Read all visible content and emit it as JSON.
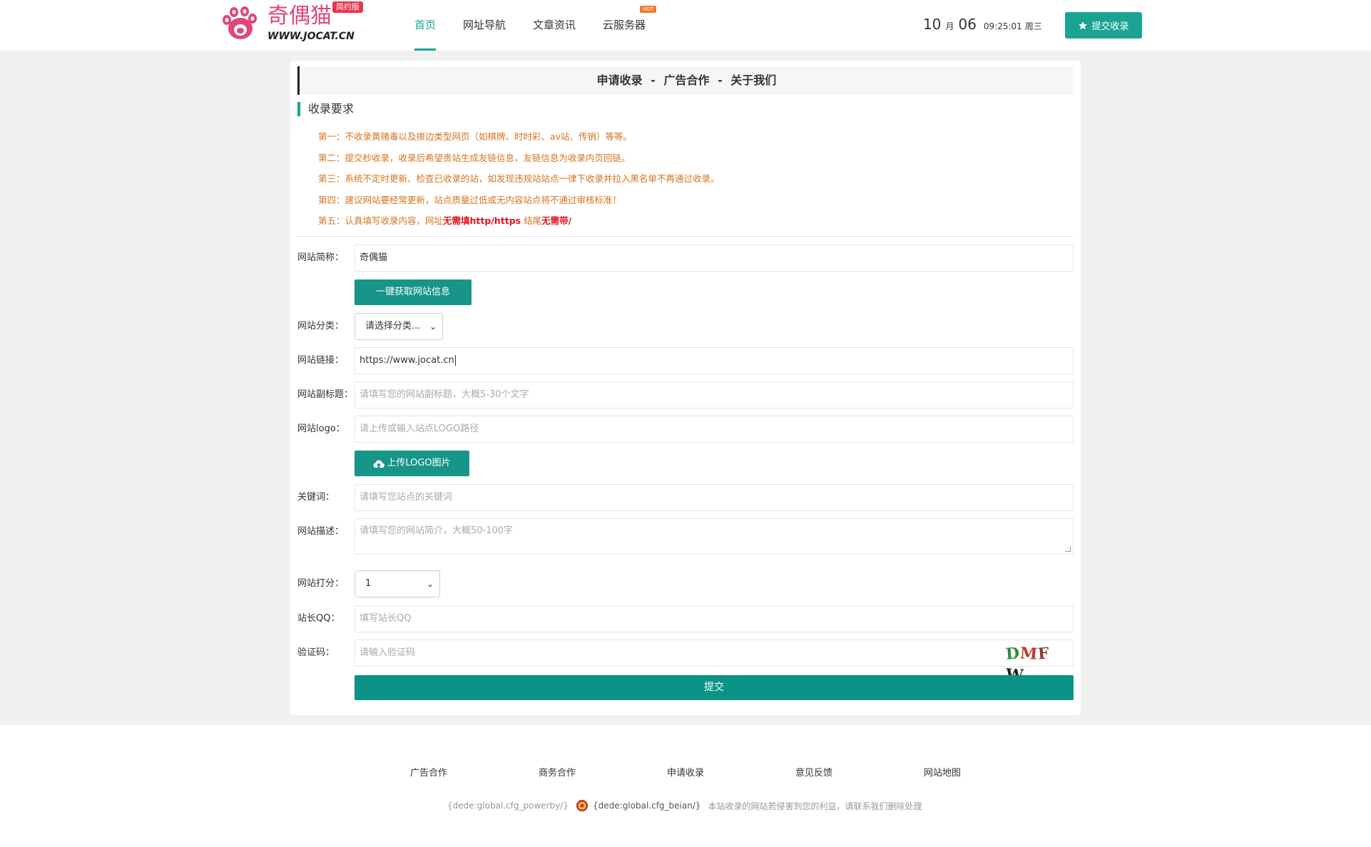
{
  "header": {
    "logo_text": "奇偶猫",
    "logo_url_text": "WWW.JOCAT.CN",
    "logo_badge": "简约版",
    "nav": [
      {
        "label": "首页",
        "active": true
      },
      {
        "label": "网址导航",
        "active": false
      },
      {
        "label": "文章资讯",
        "active": false
      },
      {
        "label": "云服务器",
        "active": false,
        "badge": "HOT"
      }
    ],
    "clock": {
      "month": "10",
      "month_unit": "月",
      "day": "06",
      "time": "09:25:01",
      "weekday": "周三"
    },
    "submit_button": "提交收录"
  },
  "card": {
    "title_parts": [
      "申请收录",
      "-",
      "广告合作",
      "-",
      "关于我们"
    ],
    "section_title": "收录要求",
    "rules": [
      {
        "text": "第一：不收录黄赌毒以及擦边类型网页（如棋牌、时时彩、av站、传销）等等。"
      },
      {
        "text": "第二：提交秒收录，收录后希望贵站生成友链信息，友链信息为收录内页回链。"
      },
      {
        "text": "第三：系统不定时更新、检查已收录的站，如发现违规站站点一律下收录并拉入黑名单不再通过收录。"
      },
      {
        "text": "第四：建议网站要经常更新，站点质量过低或无内容站点将不通过审核标准！"
      },
      {
        "prefix": "第五：认真填写收录内容，网址",
        "strong1": "无需填http/https",
        "middle": " 结尾",
        "strong2": "无需带/"
      }
    ]
  },
  "form": {
    "site_name": {
      "label": "网站简称：",
      "value": "奇偶猫"
    },
    "fetch_button": "一键获取网站信息",
    "category": {
      "label": "网站分类：",
      "value": "请选择分类..."
    },
    "url": {
      "label": "网站链接：",
      "value": "https://www.jocat.cn"
    },
    "subtitle": {
      "label": "网站副标题：",
      "placeholder": "请填写您的网站副标题，大概5-30个文字"
    },
    "logo": {
      "label": "网站logo：",
      "placeholder": "请上传或输入站点LOGO路径"
    },
    "upload_button": "上传LOGO图片",
    "keywords": {
      "label": "关键词：",
      "placeholder": "请填写您站点的关键词"
    },
    "description": {
      "label": "网站描述：",
      "placeholder": "请填写您的网站简介，大概50-100字"
    },
    "rating": {
      "label": "网站打分：",
      "value": "1"
    },
    "qq": {
      "label": "站长QQ：",
      "placeholder": "填写站长QQ"
    },
    "captcha": {
      "label": "验证码：",
      "placeholder": "请输入验证码",
      "code": "DMFW"
    },
    "submit": "提交"
  },
  "footer": {
    "links": [
      "广告合作",
      "商务合作",
      "申请收录",
      "意见反馈",
      "网站地图"
    ],
    "powerby": "{dede:global.cfg_powerby/}",
    "beian": "{dede:global.cfg_beian/}",
    "notice": "本站收录的网站若侵害到您的利益，请联系我们删除处理"
  },
  "colors": {
    "accent": "#1aa394",
    "rule_text": "#d8731f",
    "rule_strong": "#e6121e",
    "logo": "#e0457b"
  }
}
